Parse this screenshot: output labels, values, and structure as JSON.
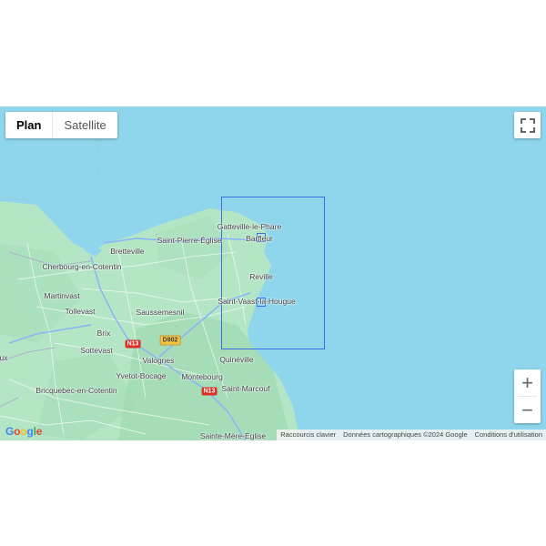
{
  "map_type": {
    "plan": "Plan",
    "satellite": "Satellite",
    "selected": "Plan"
  },
  "controls": {
    "fullscreen_icon": "fullscreen-icon",
    "zoom_in": "+",
    "zoom_out": "−"
  },
  "places": {
    "gatteville": "Gatteville-le-Phare",
    "barfleur": "Barfleur",
    "st_pierre": "Saint-Pierre-Église",
    "bretteville": "Bretteville",
    "cherbourg": "Cherbourg-en-Cotentin",
    "martinvast": "Martinvast",
    "tollevast": "Tollevast",
    "reville": "Reville",
    "st_vaast": "Saint-Vaast-la-Hougue",
    "saussemesnil": "Saussemesnil",
    "brix": "Brix",
    "sottevast": "Sottevast",
    "valognes": "Valognes",
    "yvetot": "Yvetot-Bocage",
    "montebourg": "Montebourg",
    "quineville": "Quinéville",
    "bricquebec": "Bricquebec-en-Cotentin",
    "st_marcouf": "Saint-Marcouf",
    "ste_mere": "Sainte-Mère-Église",
    "partial_left": "ux"
  },
  "roads": {
    "n13_a": "N13",
    "n13_b": "N13",
    "d902": "D902"
  },
  "footer": {
    "shortcuts": "Raccourcis clavier",
    "data": "Données cartographiques ©2024 Google",
    "terms": "Conditions d'utilisation"
  },
  "logo": "Google",
  "colors": {
    "sea": "#8fd6ec",
    "land": "#b3e6c8",
    "selection": "#3d6ee8"
  }
}
